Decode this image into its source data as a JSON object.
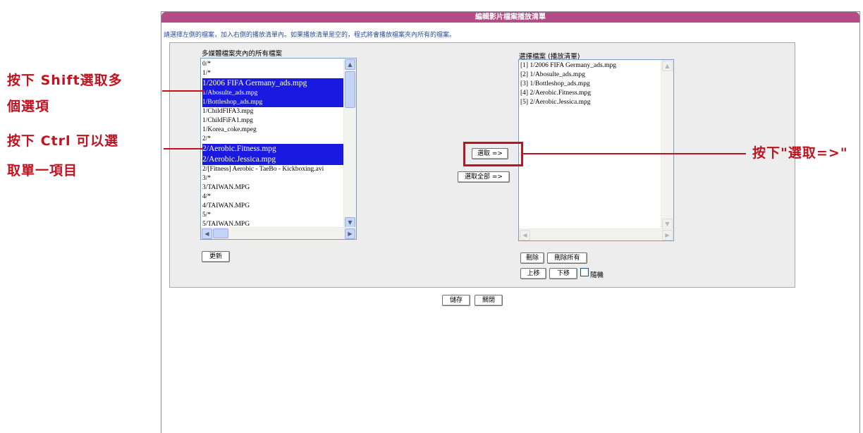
{
  "dialog": {
    "title": "編輯影片檔案播放清單",
    "hint": "請選擇左側的檔案，加入右側的播放清單內。如果播放清單是空的，程式將會播放檔案夾內所有的檔案。"
  },
  "left_list": {
    "caption": "多媒體檔案夾內的所有檔案",
    "items": [
      {
        "text": "0/*",
        "selected": false
      },
      {
        "text": "1/*",
        "selected": false
      },
      {
        "text": "1/2006 FIFA Germany_ads.mpg",
        "selected": true
      },
      {
        "text": "1/Abosulte_ads.mpg",
        "selected": true
      },
      {
        "text": "1/Bottleshop_ads.mpg",
        "selected": true
      },
      {
        "text": "1/ChildFIFA3.mpg",
        "selected": false
      },
      {
        "text": "1/ChildFiFA1.mpg",
        "selected": false
      },
      {
        "text": "1/Korea_coke.mpeg",
        "selected": false
      },
      {
        "text": "2/*",
        "selected": false
      },
      {
        "text": "2/Aerobic.Fitness.mpg",
        "selected": true
      },
      {
        "text": "2/Aerobic.Jessica.mpg",
        "selected": true
      },
      {
        "text": "2/[Fitness] Aerobic - TaeBo - Kickboxing.avi",
        "selected": false
      },
      {
        "text": "3/*",
        "selected": false
      },
      {
        "text": "3/TAIWAN.MPG",
        "selected": false
      },
      {
        "text": "4/*",
        "selected": false
      },
      {
        "text": "4/TAIWAN.MPG",
        "selected": false
      },
      {
        "text": "5/*",
        "selected": false
      },
      {
        "text": "5/TAIWAN.MPG",
        "selected": false
      }
    ],
    "refresh_label": "更新"
  },
  "middle": {
    "select_label": "選取 =>",
    "select_all_label": "選取全部 =>"
  },
  "right_list": {
    "caption": "選擇檔案 (播放清單)",
    "items": [
      "[1] 1/2006 FIFA Germany_ads.mpg",
      "[2] 1/Abosulte_ads.mpg",
      "[3] 1/Bottleshop_ads.mpg",
      "[4] 2/Aerobic.Fitness.mpg",
      "[5] 2/Aerobic.Jessica.mpg"
    ],
    "delete_label": "刪除",
    "delete_all_label": "刪除所有",
    "move_up_label": "上移",
    "move_down_label": "下移",
    "shuffle_label": "隨機",
    "shuffle_checked": false
  },
  "footer": {
    "save_label": "儲存",
    "close_label": "關閉"
  },
  "annotations": {
    "shift_line1": "按下 Shift選取多",
    "shift_line2": "個選項",
    "ctrl_line1": "按下 Ctrl 可以選",
    "ctrl_line2": "取單一項目",
    "select_note": "按下\"選取=>\""
  },
  "colors": {
    "title_bar": "#b34c87",
    "selection": "#1919e0",
    "annotation": "#c1121f"
  }
}
